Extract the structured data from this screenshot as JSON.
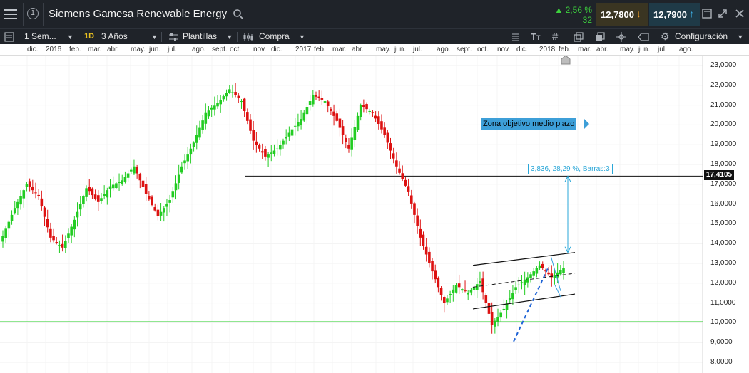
{
  "header": {
    "menu_icon": "hamburger-icon",
    "info_badge": "1",
    "instrument_name": "Siemens Gamesa Renewable Energy",
    "change_percent": "▲ 2,56 %",
    "change_points": "32",
    "sell_price": "12,7800",
    "buy_price": "12,7900"
  },
  "toolbar": {
    "period": "1 Sem...",
    "range_badge": "1D",
    "range": "3 Años",
    "templates": "Plantillas",
    "order": "Compra",
    "settings": "Configuración"
  },
  "time_axis": [
    "dic.",
    "2016",
    "feb.",
    "mar.",
    "abr.",
    "may.",
    "jun.",
    "jul.",
    "ago.",
    "sept.",
    "oct.",
    "nov.",
    "dic.",
    "2017",
    "feb.",
    "mar.",
    "abr.",
    "may.",
    "jun.",
    "jul.",
    "ago.",
    "sept.",
    "oct.",
    "nov.",
    "dic.",
    "2018",
    "feb.",
    "mar.",
    "abr.",
    "may.",
    "jun.",
    "jul.",
    "ago."
  ],
  "price_axis": [
    "23,0000",
    "22,0000",
    "21,0000",
    "20,0000",
    "19,0000",
    "18,0000",
    "17,0000",
    "16,0000",
    "15,0000",
    "14,0000",
    "13,0000",
    "12,0000",
    "11,0000",
    "10,0000",
    "9,0000",
    "8,0000"
  ],
  "annotations": {
    "level_price": "17,4105",
    "zone_label": "Zona objetivo medio plazo",
    "measure_label": "3,836, 28,29 %, Barras:3"
  },
  "colors": {
    "up": "#22cc22",
    "down": "#dd1111",
    "accent": "#2aa7d8",
    "support_line": "#22cc22"
  },
  "chart_data": {
    "type": "candlestick",
    "title": "",
    "xlabel": "",
    "ylabel": "",
    "ylim": [
      8,
      23.5
    ],
    "x_range": [
      "2015-11",
      "2018-08"
    ],
    "grid": true,
    "horizontal_levels": [
      17.4105,
      10.05
    ],
    "target_zone_label": "Zona objetivo medio plazo",
    "candles_approx_close": [
      14.4,
      15.8,
      17.0,
      16.4,
      14.3,
      13.8,
      15.2,
      16.8,
      16.1,
      16.9,
      17.2,
      17.9,
      16.5,
      15.4,
      16.2,
      17.9,
      19.1,
      20.6,
      21.1,
      21.8,
      21.2,
      19.2,
      18.4,
      18.8,
      19.6,
      20.3,
      21.5,
      21.2,
      20.2,
      18.8,
      21.0,
      20.6,
      19.5,
      17.9,
      16.6,
      14.3,
      12.6,
      11.0,
      11.9,
      11.5,
      12.1,
      9.9,
      10.7,
      11.8,
      12.3,
      12.9,
      12.3,
      12.78
    ],
    "channel_upper": [
      [
        663,
        12.9
      ],
      [
        806,
        13.55
      ]
    ],
    "channel_lower": [
      [
        663,
        10.7
      ],
      [
        806,
        11.45
      ]
    ],
    "channel_mid": [
      [
        663,
        11.8
      ],
      [
        806,
        12.5
      ]
    ],
    "measure": {
      "from": 13.55,
      "to": 17.4105,
      "change": 3.836,
      "percent": 28.29,
      "bars": 3
    }
  }
}
